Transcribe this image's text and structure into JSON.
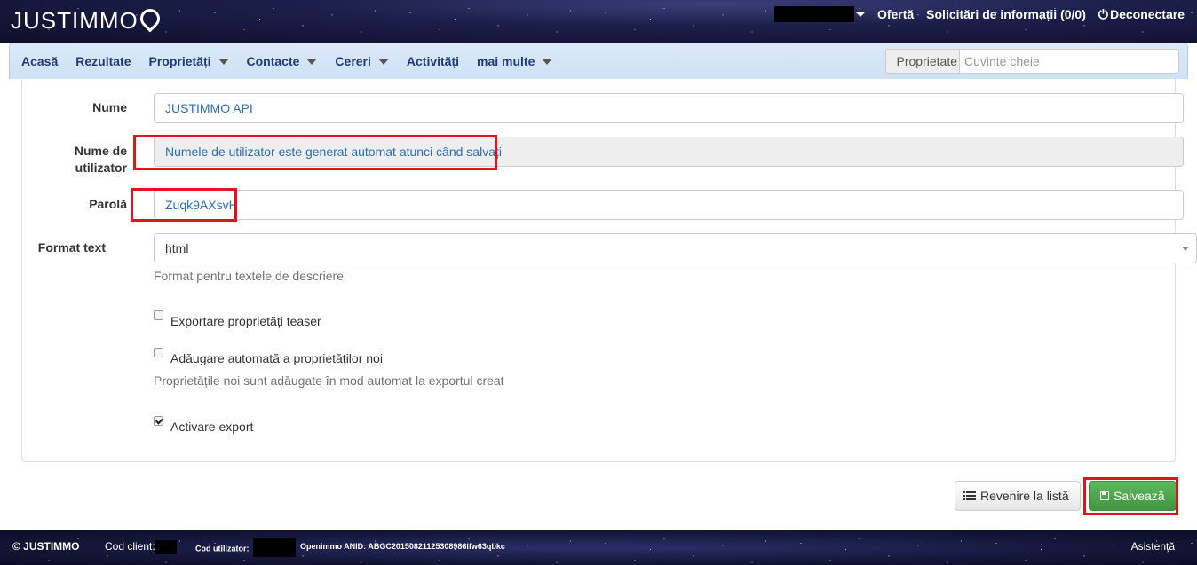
{
  "header": {
    "logo_text": "JUSTIMMO",
    "offer_link": "Ofertă",
    "requests_link": "Solicitări de informații (0/0)",
    "logout_link": "Deconectare"
  },
  "nav": {
    "items": [
      {
        "label": "Acasă",
        "dropdown": false
      },
      {
        "label": "Rezultate",
        "dropdown": false
      },
      {
        "label": "Proprietăți",
        "dropdown": true
      },
      {
        "label": "Contacte",
        "dropdown": true
      },
      {
        "label": "Cereri",
        "dropdown": true
      },
      {
        "label": "Activități",
        "dropdown": false
      },
      {
        "label": "mai multe",
        "dropdown": true
      }
    ],
    "search_addon": "Proprietate",
    "search_placeholder": "Cuvinte cheie"
  },
  "form": {
    "name_label": "Nume",
    "name_value": "JUSTIMMO API",
    "username_label_1": "Nume de",
    "username_label_2": "utilizator",
    "username_value": "Numele de utilizator este generat automat atunci când salvați",
    "password_label": "Parolă",
    "password_value": "Zuqk9AXsvH",
    "format_label": "Format text",
    "format_value": "html",
    "format_help": "Format pentru textele de descriere",
    "teaser_label": "Exportare proprietăți teaser",
    "teaser_checked": false,
    "auto_add_label": "Adăugare automată a proprietăților noi",
    "auto_add_checked": false,
    "auto_add_help": "Proprietățile noi sunt adăugate în mod automat la exportul creat",
    "activate_label": "Activare export",
    "activate_checked": true
  },
  "actions": {
    "back_label": "Revenire la listă",
    "save_label": "Salvează"
  },
  "footer": {
    "copyright": "© JUSTIMMO",
    "client_code_label": "Cod client:",
    "user_code_label": "Cod utilizator:",
    "anid": "Openimmo ANID: ABGC20150821125308986lfw63qbkc",
    "help_link": "Asistență"
  },
  "colors": {
    "highlight": "#e0141e",
    "nav_text": "#1e3d78",
    "input_text": "#2a6fbd",
    "success": "#5cb85c"
  }
}
